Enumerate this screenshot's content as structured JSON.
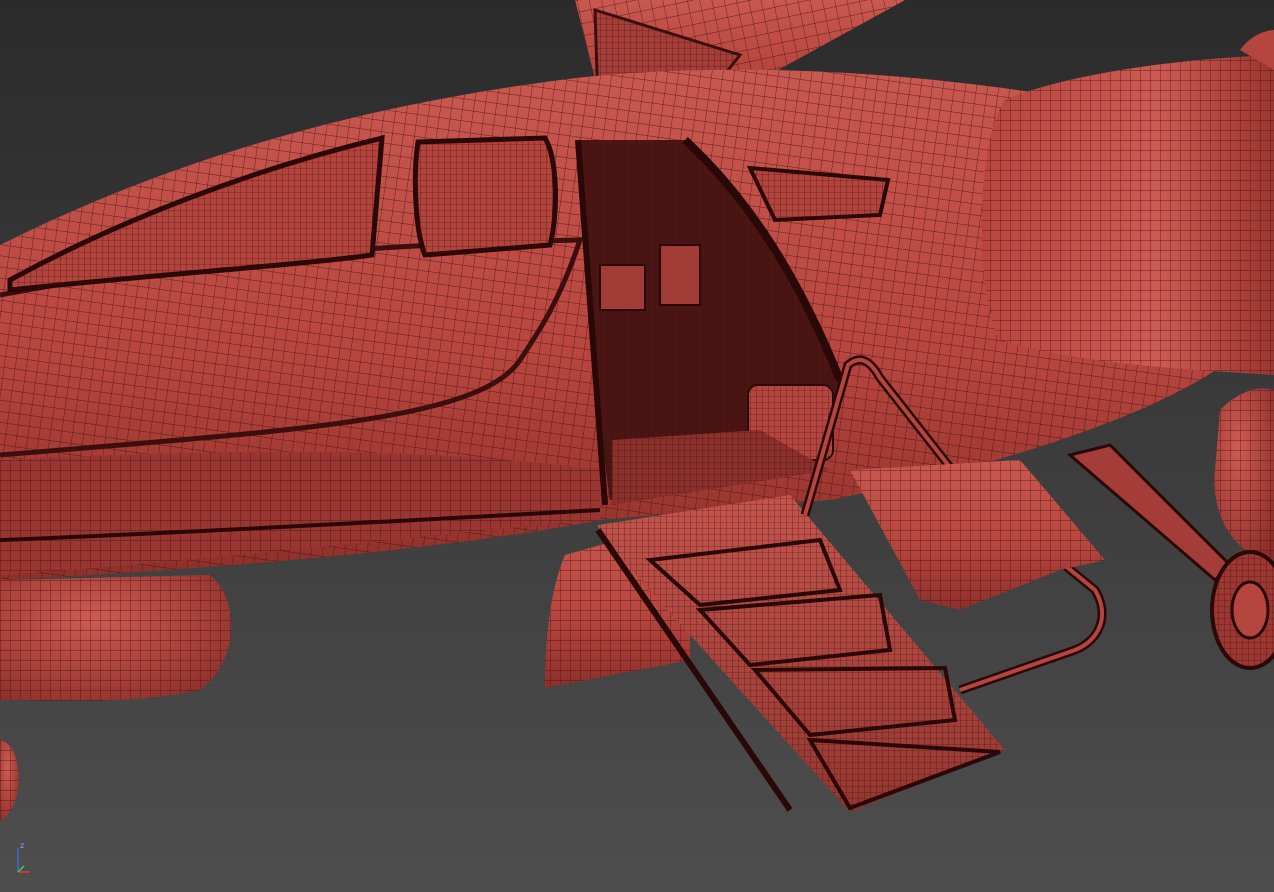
{
  "viewport": {
    "mode": "wireframe-on-shaded",
    "background_color": "#3a3a3a",
    "mesh_color": "#b94a44",
    "wire_color": "#3c0f0f",
    "highlight_color": "#d45e56",
    "shadow_color": "#7a2a26"
  },
  "scene": {
    "objects": [
      "fuselage",
      "cabin-windows",
      "open-door-panel",
      "cabin-interior",
      "boarding-stairs",
      "stair-handrail",
      "engine-nacelle",
      "wing-strut",
      "main-gear-wheel",
      "fairing-pod"
    ]
  },
  "axis_gizmo": {
    "labels": [
      "z",
      "y",
      "x"
    ],
    "colors": {
      "x": "#d33b3b",
      "y": "#3bd34a",
      "z": "#3b6bd3"
    }
  }
}
